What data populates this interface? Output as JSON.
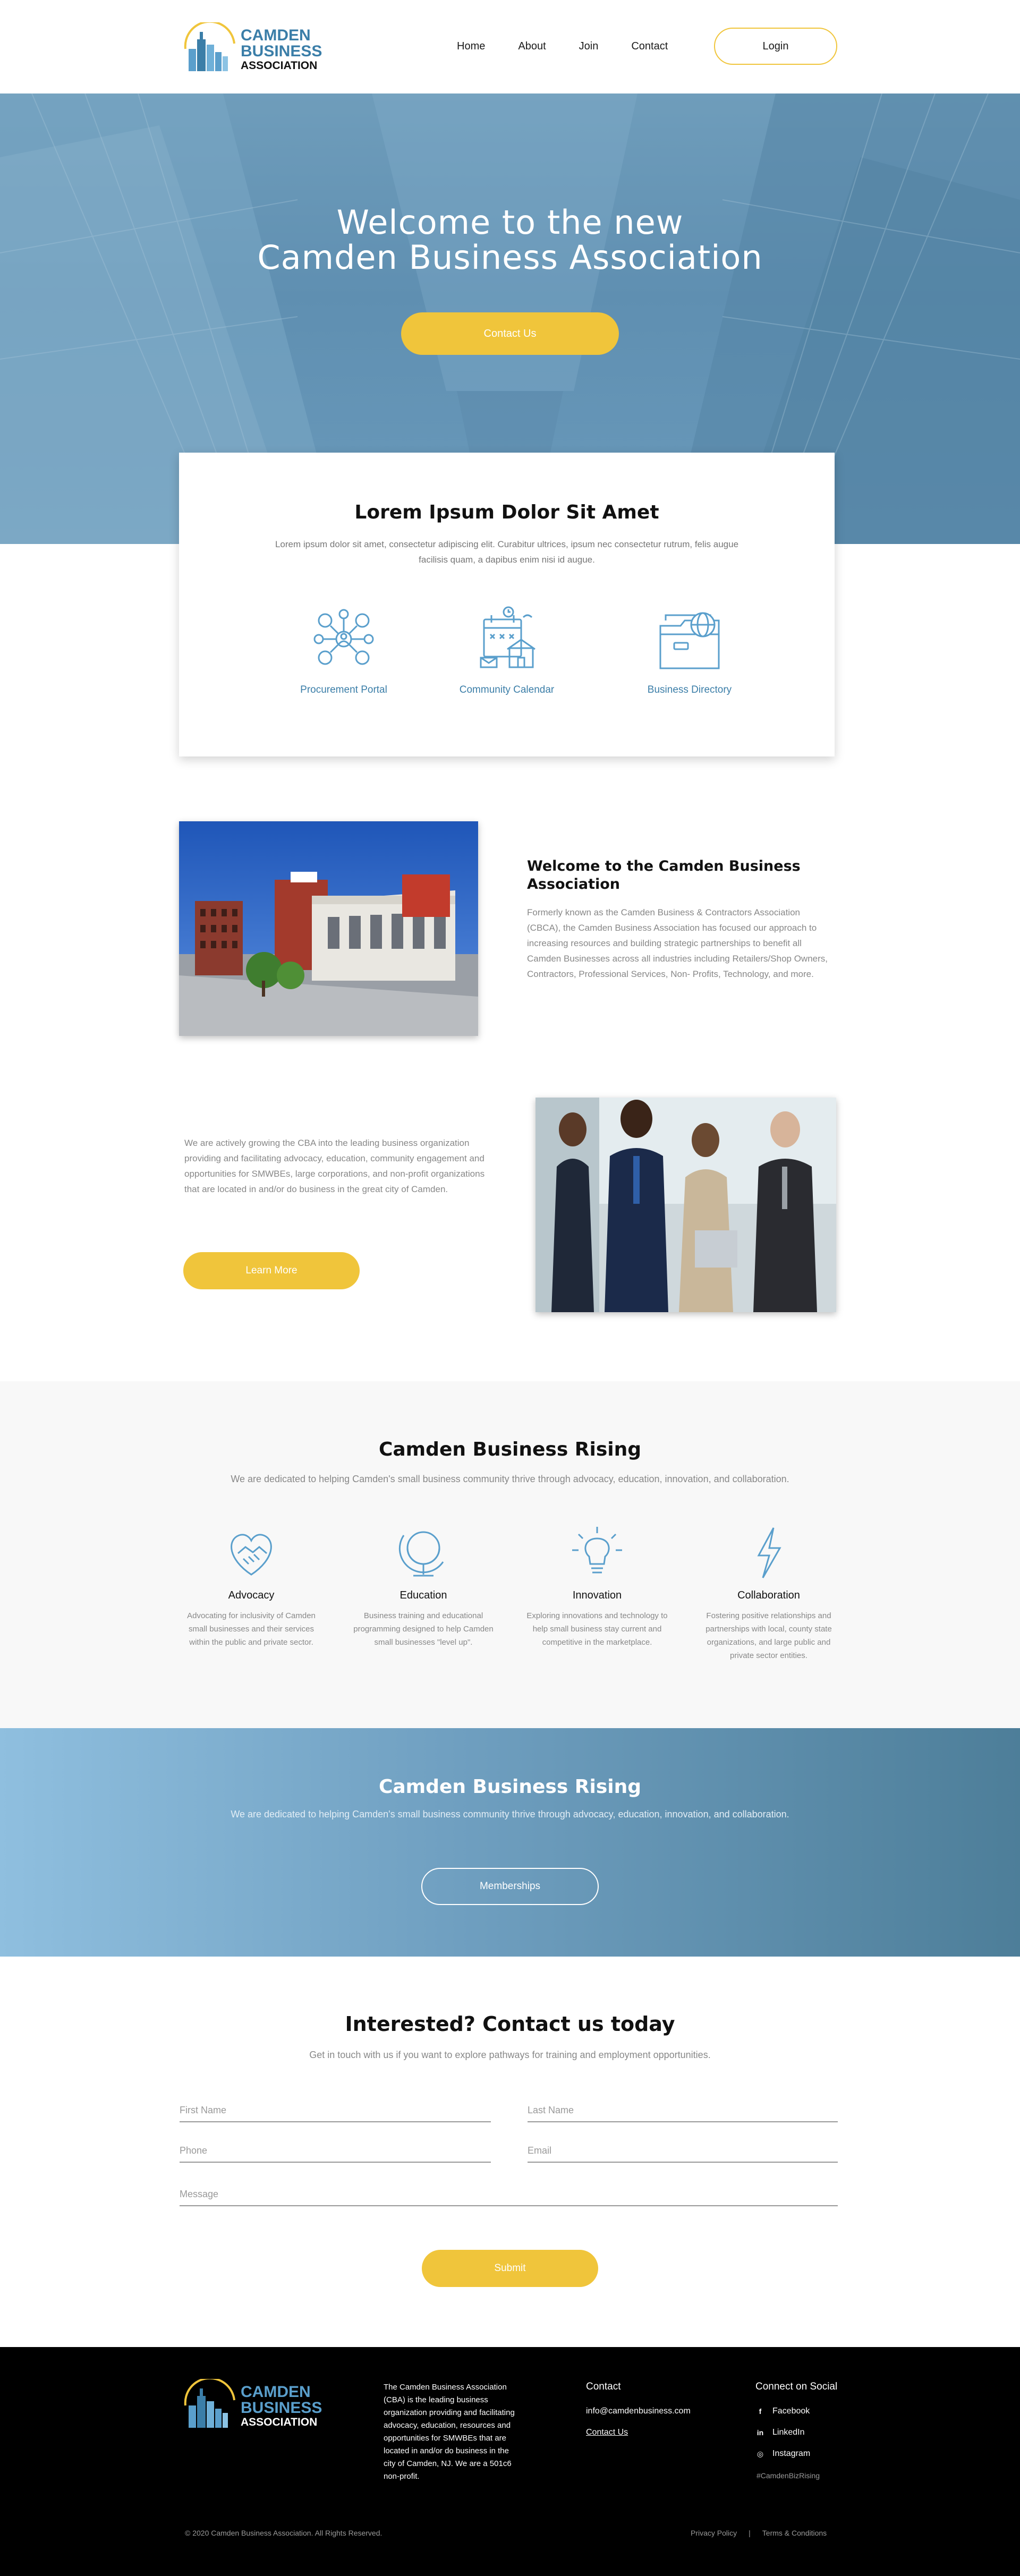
{
  "header": {
    "logo": {
      "line1": "CAMDEN",
      "line2": "BUSINESS",
      "line3": "ASSOCIATION"
    },
    "nav": [
      "Home",
      "About",
      "Join",
      "Contact"
    ],
    "login_label": "Login"
  },
  "hero": {
    "title_line1": "Welcome to the new",
    "title_line2": "Camden Business Association",
    "cta_label": "Contact Us"
  },
  "card": {
    "title": "Lorem Ipsum Dolor Sit Amet",
    "text": "Lorem ipsum dolor sit amet, consectetur adipiscing elit. Curabitur ultrices, ipsum nec consectetur rutrum, felis augue facilisis quam, a dapibus enim nisi id augue.",
    "features": [
      {
        "label": "Procurement Portal",
        "icon": "network-people-icon"
      },
      {
        "label": "Community Calendar",
        "icon": "calendar-building-icon"
      },
      {
        "label": "Business Directory",
        "icon": "folder-globe-icon"
      }
    ]
  },
  "welcome": {
    "title": "Welcome to the Camden Business Association",
    "text": "Formerly known as the Camden Business & Contractors Association (CBCA), the Camden Business Association has focused our approach to increasing resources and building strategic partnerships to benefit all Camden Businesses across all industries including Retailers/Shop Owners, Contractors, Professional Services, Non- Profits, Technology, and more."
  },
  "growing": {
    "text": "We are actively growing the CBA into the leading business organization providing and facilitating advocacy, education, community engagement and opportunities for SMWBEs, large corporations, and non-profit organizations that are located in and/or do business in the great city of Camden.",
    "button_label": "Learn More"
  },
  "rising": {
    "title": "Camden Business Rising",
    "subtitle": "We are dedicated to helping Camden's small business community thrive through advocacy, education, innovation, and collaboration.",
    "pillars": [
      {
        "title": "Advocacy",
        "text": "Advocating for inclusivity of Camden small businesses and their services within the public and private sector.",
        "icon": "handshake-heart-icon"
      },
      {
        "title": "Education",
        "text": "Business training and educational programming designed to help Camden small businesses \"level up\".",
        "icon": "globe-icon"
      },
      {
        "title": "Innovation",
        "text": "Exploring innovations and technology to help small business stay current and competitive in the marketplace.",
        "icon": "lightbulb-icon"
      },
      {
        "title": "Collaboration",
        "text": "Fostering positive relationships and partnerships with local, county state organizations, and large public and private sector entities.",
        "icon": "lightning-icon"
      }
    ]
  },
  "band": {
    "title": "Camden Business Rising",
    "subtitle": "We are dedicated to helping Camden's small business community thrive through advocacy, education, innovation, and collaboration.",
    "button_label": "Memberships"
  },
  "contact": {
    "title": "Interested? Contact us today",
    "subtitle": "Get in touch with us if you want to explore pathways for training and employment opportunities.",
    "fields": {
      "first_name": "First Name",
      "last_name": "Last Name",
      "phone": "Phone",
      "email": "Email",
      "message": "Message"
    },
    "submit_label": "Submit"
  },
  "footer": {
    "about": "The Camden Business Association (CBA) is the leading business organization providing and facilitating advocacy, education, resources and opportunities for SMWBEs that are located in and/or do business in the city of Camden, NJ. We are a 501c6 non-profit.",
    "contact_heading": "Contact",
    "email": "info@camdenbusiness.com",
    "contact_link": "Contact Us",
    "social_heading": "Connect on Social",
    "social": [
      {
        "label": "Facebook",
        "icon": "facebook-icon",
        "glyph": "f"
      },
      {
        "label": "LinkedIn",
        "icon": "linkedin-icon",
        "glyph": "in"
      },
      {
        "label": "Instagram",
        "icon": "instagram-icon",
        "glyph": "◎"
      }
    ],
    "hashtag": "#CamdenBizRising",
    "copyright": "© 2020 Camden Business Association. All Rights Reserved.",
    "links": [
      "Privacy Policy",
      "|",
      "Terms & Conditions"
    ]
  },
  "colors": {
    "accent_yellow": "#f0c53b",
    "brand_blue": "#3b7ea8",
    "icon_blue": "#5a9fcc",
    "hero_blue": "#6a9abb"
  }
}
